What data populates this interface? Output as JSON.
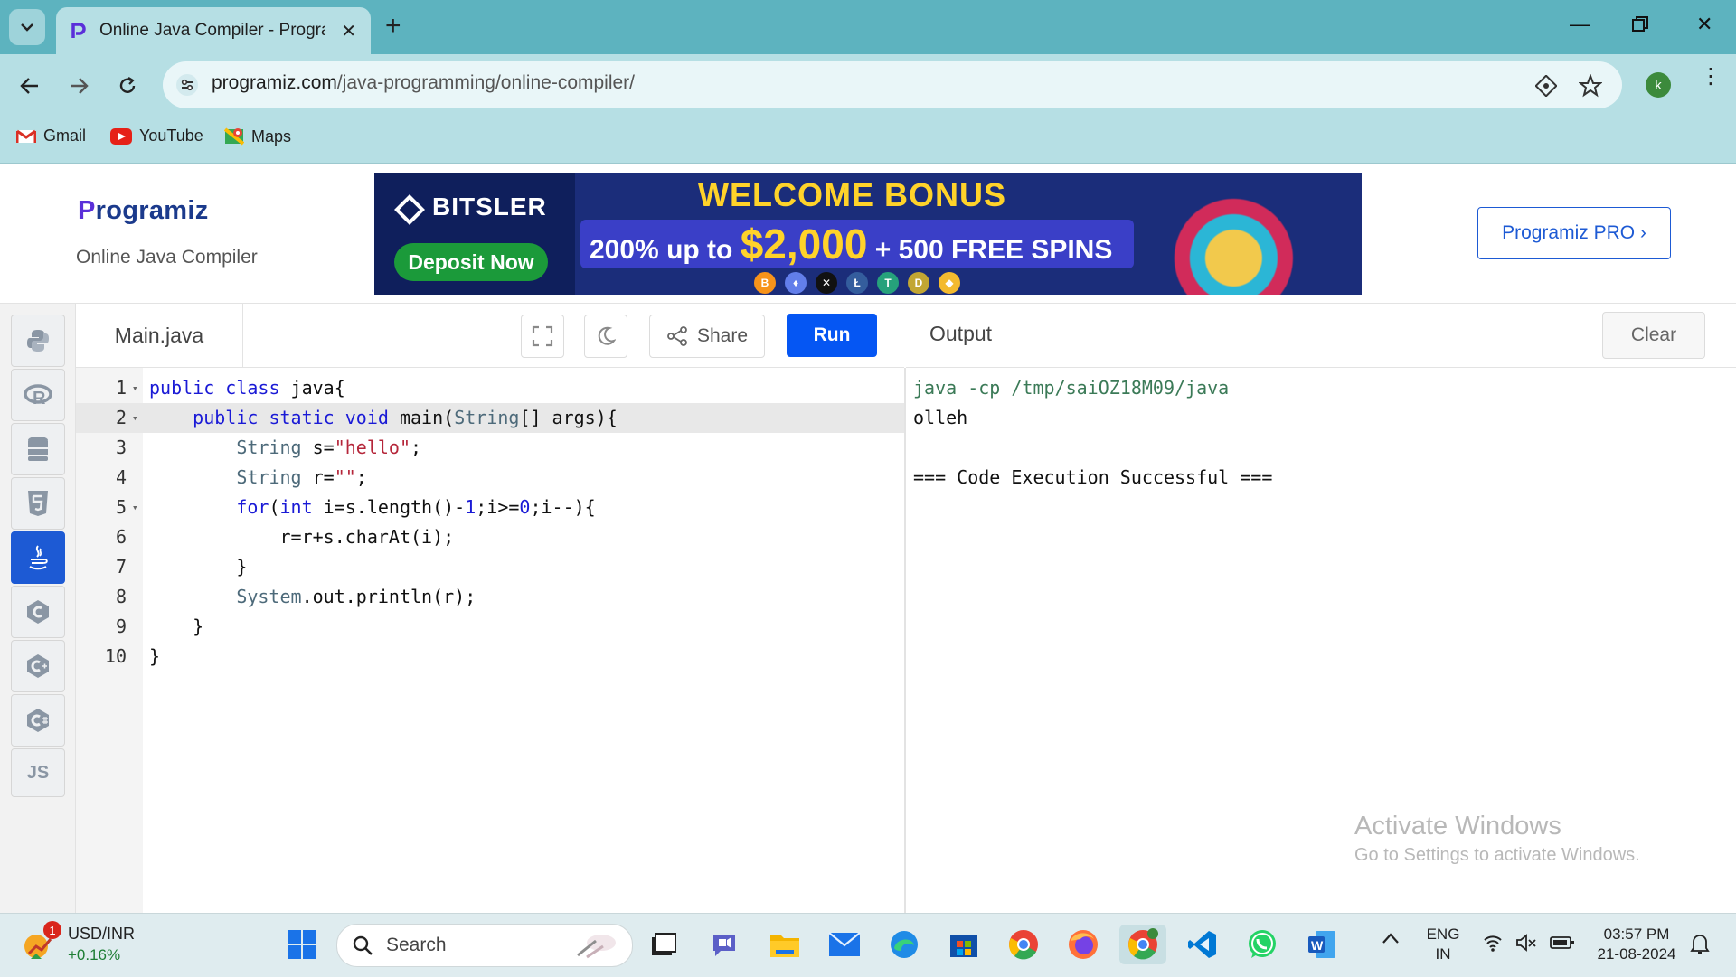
{
  "browser": {
    "tab_title": "Online Java Compiler - Programiz",
    "url_domain": "programiz.com",
    "url_path": "/java-programming/online-compiler/",
    "profile_initial": "k",
    "bookmarks": [
      {
        "label": "Gmail",
        "icon": "gmail-icon"
      },
      {
        "label": "YouTube",
        "icon": "youtube-icon"
      },
      {
        "label": "Maps",
        "icon": "maps-icon"
      }
    ],
    "colors": {
      "tabbar": "#5db3bf",
      "toolbar": "#b6dfe4"
    }
  },
  "site": {
    "logo_text": "rogramiz",
    "logo_p": "P",
    "subtitle": "Online Java Compiler",
    "pro_button": "Programiz PRO ›",
    "ad": {
      "brand": "BITSLER",
      "cta": "Deposit Now",
      "headline": "WELCOME BONUS",
      "offer_prefix": "200% up to ",
      "offer_amount": "$2,000",
      "offer_suffix": " + 500 FREE SPINS",
      "coins": [
        "B",
        "♦",
        "✕",
        "Ł",
        "T",
        "D",
        "◆"
      ]
    },
    "accent_color": "#0556f3"
  },
  "languages": [
    {
      "name": "python-icon",
      "label": ""
    },
    {
      "name": "r-icon",
      "label": ""
    },
    {
      "name": "sql-icon",
      "label": ""
    },
    {
      "name": "html5-icon",
      "label": ""
    },
    {
      "name": "java-icon",
      "label": "",
      "active": true
    },
    {
      "name": "c-icon",
      "label": ""
    },
    {
      "name": "cpp-icon",
      "label": ""
    },
    {
      "name": "csharp-icon",
      "label": ""
    },
    {
      "name": "js-icon",
      "label": "JS"
    }
  ],
  "editor": {
    "file_name": "Main.java",
    "share_label": "Share",
    "run_label": "Run",
    "current_line": 2,
    "lines": [
      {
        "n": "1",
        "fold": true,
        "html": "<span class=\"kw\">public</span> <span class=\"kw\">class</span> java{"
      },
      {
        "n": "2",
        "fold": true,
        "html": "    <span class=\"kw\">public</span> <span class=\"kw\">static</span> <span class=\"kw\">void</span> main(<span class=\"typ\">String</span>[] args){"
      },
      {
        "n": "3",
        "fold": false,
        "html": "        <span class=\"typ\">String</span> s=<span class=\"str\">\"hello\"</span>;"
      },
      {
        "n": "4",
        "fold": false,
        "html": "        <span class=\"typ\">String</span> r=<span class=\"str\">\"\"</span>;"
      },
      {
        "n": "5",
        "fold": true,
        "html": "        <span class=\"kw\">for</span>(<span class=\"kw\">int</span> i=s.length()-<span class=\"num\">1</span>;i&gt;=<span class=\"num\">0</span>;i--){"
      },
      {
        "n": "6",
        "fold": false,
        "html": "            r=r+s.charAt(i);"
      },
      {
        "n": "7",
        "fold": false,
        "html": "        }"
      },
      {
        "n": "8",
        "fold": false,
        "html": "        <span class=\"typ\">System</span>.out.println(r);"
      },
      {
        "n": "9",
        "fold": false,
        "html": "    }"
      },
      {
        "n": "10",
        "fold": false,
        "html": "}"
      }
    ]
  },
  "output": {
    "title": "Output",
    "clear_label": "Clear",
    "lines": [
      {
        "text": "java -cp /tmp/saiOZ18M09/java",
        "color": "#3b7a57"
      },
      {
        "text": "olleh",
        "color": "#111111"
      },
      {
        "text": "",
        "color": "#111111"
      },
      {
        "text": "=== Code Execution Successful ===",
        "color": "#111111"
      }
    ],
    "watermark_title": "Activate Windows",
    "watermark_sub": "Go to Settings to activate Windows."
  },
  "taskbar": {
    "ticker_symbol": "USD/INR",
    "ticker_change": "+0.16%",
    "ticker_badge": "1",
    "search_placeholder": "Search",
    "lang_top": "ENG",
    "lang_bottom": "IN",
    "time": "03:57 PM",
    "date": "21-08-2024",
    "apps": [
      "start-icon",
      "file-explorer-icon",
      "teams-icon",
      "folder-icon",
      "mail-icon",
      "edge-icon",
      "store-icon",
      "chrome-icon",
      "firefox-icon",
      "chrome-profile-icon",
      "vscode-icon",
      "whatsapp-icon",
      "word-icon"
    ]
  }
}
